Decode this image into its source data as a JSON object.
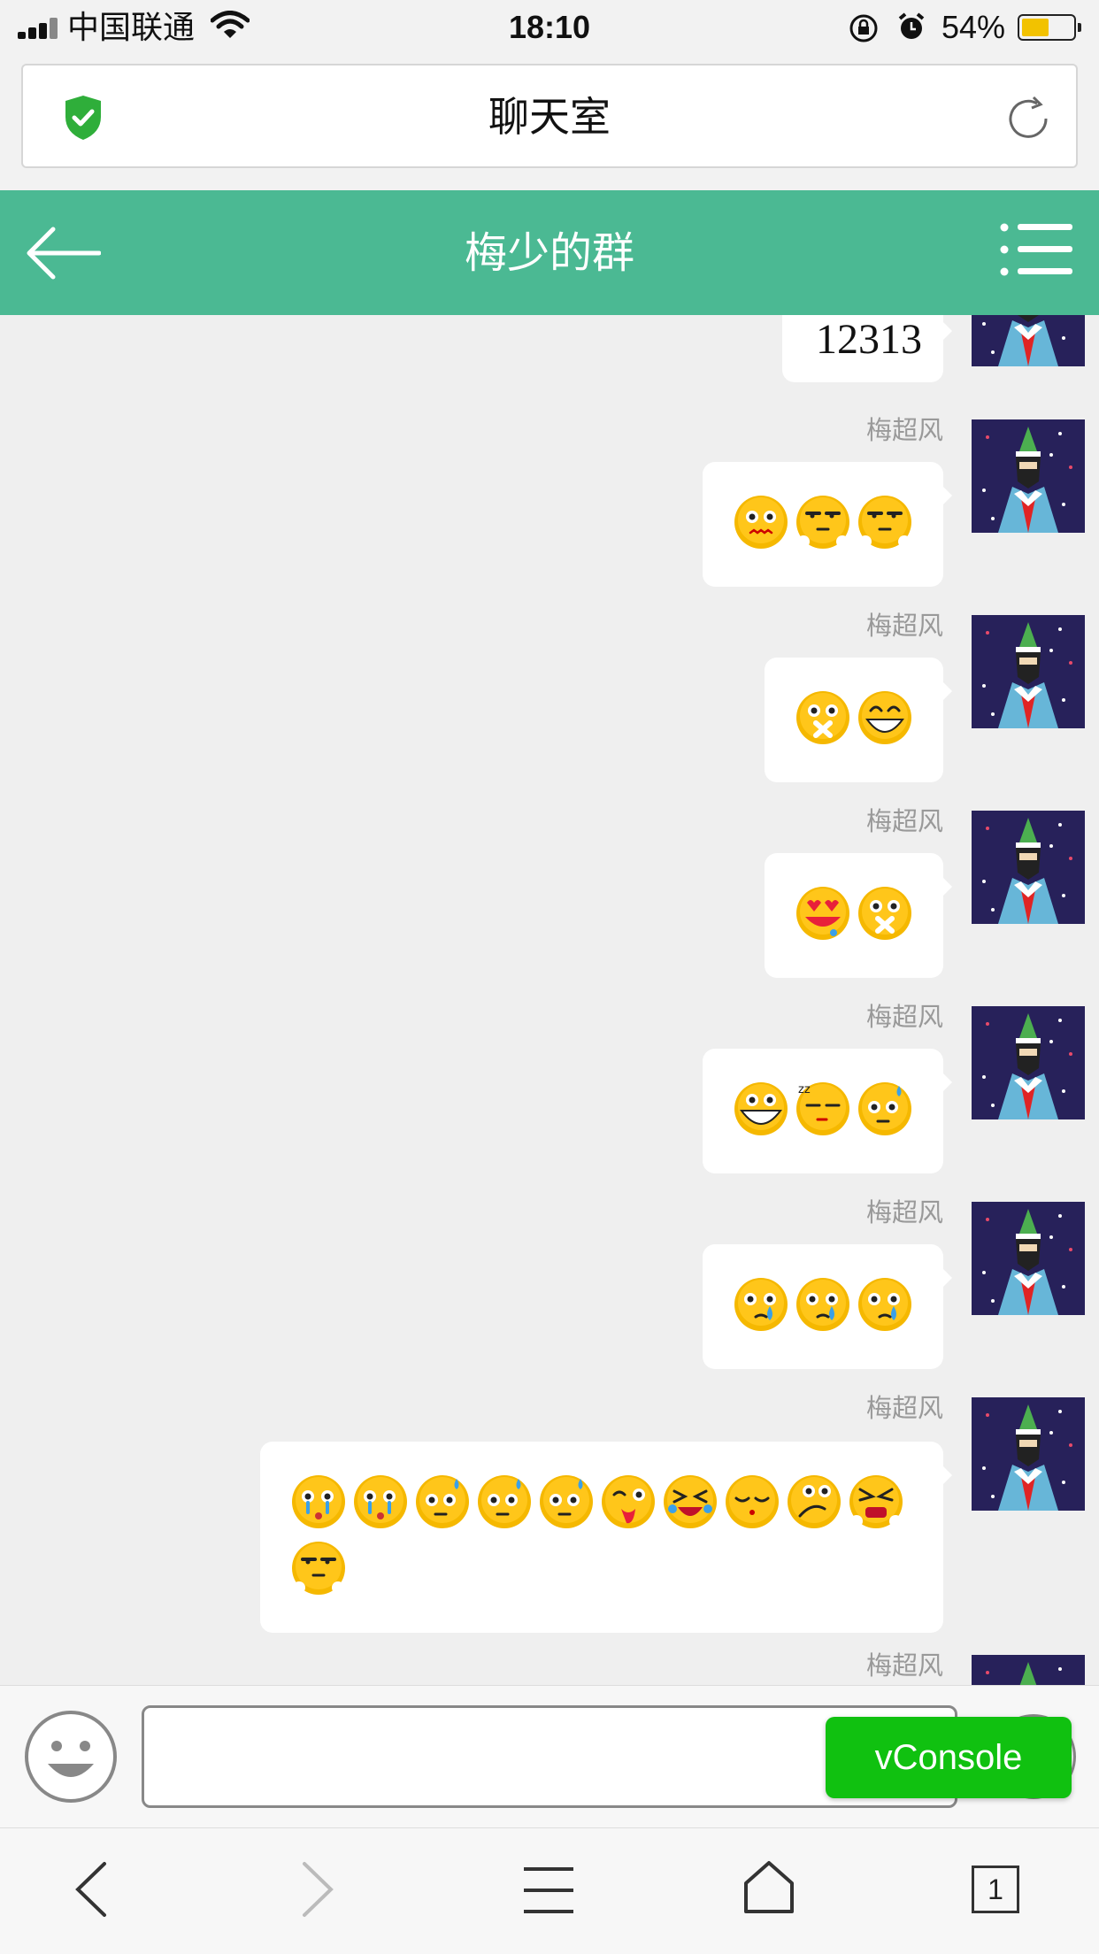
{
  "status_bar": {
    "carrier": "中国联通",
    "time": "18:10",
    "battery_percent": "54%",
    "battery_level": 0.54,
    "icons": [
      "signal-icon",
      "wifi-icon",
      "rotation-lock-icon",
      "alarm-icon",
      "battery-icon"
    ]
  },
  "browser": {
    "page_title": "聊天室",
    "icons": [
      "shield-check-icon",
      "reload-icon"
    ]
  },
  "header": {
    "title": "梅少的群",
    "icons": [
      "back-arrow-icon",
      "menu-icon"
    ]
  },
  "messages": [
    {
      "sender": "",
      "type": "text",
      "text": "12313"
    },
    {
      "sender": "梅超风",
      "type": "emoji",
      "emojis": [
        "nervous",
        "smug",
        "smug"
      ]
    },
    {
      "sender": "梅超风",
      "type": "emoji",
      "emojis": [
        "shush",
        "grin"
      ]
    },
    {
      "sender": "梅超风",
      "type": "emoji",
      "emojis": [
        "love-drool",
        "shush"
      ]
    },
    {
      "sender": "梅超风",
      "type": "emoji",
      "emojis": [
        "grin-big",
        "sleepy",
        "sweat"
      ]
    },
    {
      "sender": "梅超风",
      "type": "emoji",
      "emojis": [
        "tear",
        "tear",
        "tear"
      ]
    },
    {
      "sender": "梅超风",
      "type": "emoji",
      "emojis": [
        "cry",
        "cry",
        "sweat",
        "sweat",
        "sweat",
        "wink-tongue",
        "laugh-cry",
        "squint",
        "confused",
        "angry",
        "smug"
      ]
    },
    {
      "sender": "梅超风",
      "type": "emoji",
      "emojis": []
    }
  ],
  "input": {
    "value": "",
    "placeholder": "",
    "icons": [
      "smiley-icon",
      "send-icon"
    ]
  },
  "vconsole_label": "vConsole",
  "toolbar": {
    "tab_count": "1",
    "icons": [
      "back-icon",
      "forward-icon",
      "menu-icon",
      "home-icon",
      "tabs-icon"
    ]
  },
  "colors": {
    "header_green": "#4bb993",
    "vconsole_green": "#10c110",
    "avatar_bg": "#27215a",
    "emoji_yellow": "#f5b800"
  }
}
